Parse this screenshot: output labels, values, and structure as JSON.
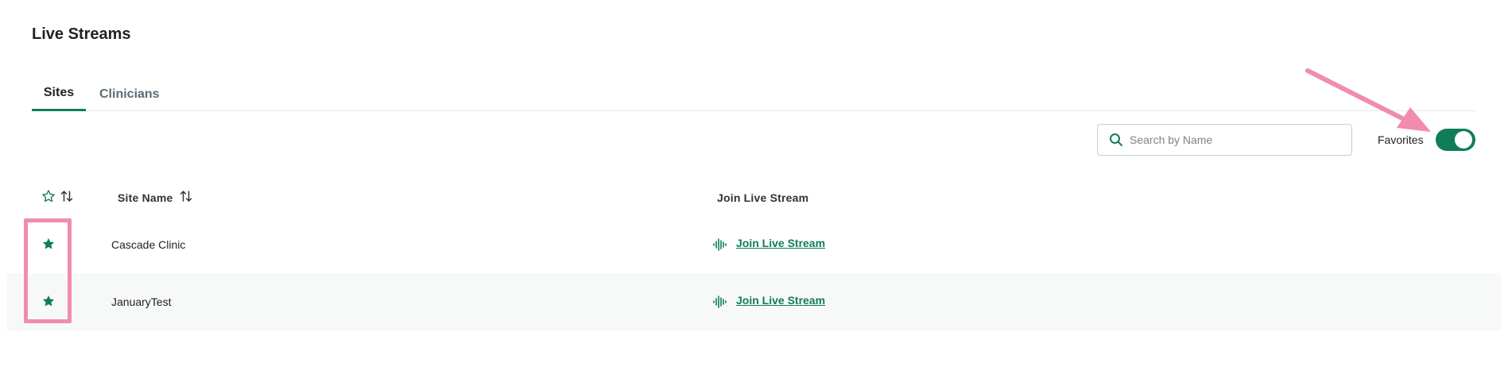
{
  "page": {
    "title": "Live Streams"
  },
  "tabs": [
    {
      "label": "Sites",
      "active": true
    },
    {
      "label": "Clinicians",
      "active": false
    }
  ],
  "search": {
    "placeholder": "Search by Name",
    "value": ""
  },
  "favorites_toggle": {
    "label": "Favorites",
    "on": true
  },
  "table": {
    "columns": {
      "site_name": "Site Name",
      "join": "Join Live Stream"
    },
    "rows": [
      {
        "favorite": true,
        "site_name": "Cascade Clinic",
        "join_label": "Join Live Stream"
      },
      {
        "favorite": true,
        "site_name": "JanuaryTest",
        "join_label": "Join Live Stream"
      }
    ]
  },
  "icons": {
    "search": "search-icon",
    "favorite_header": "star-outline-icon",
    "sort": "sort-arrows-icon",
    "favorite_row": "star-filled-icon",
    "stream": "audio-wave-icon"
  },
  "colors": {
    "accent": "#0f7d5a",
    "annotation": "#f28bb0",
    "row_alt_bg": "#f7f9f8"
  }
}
